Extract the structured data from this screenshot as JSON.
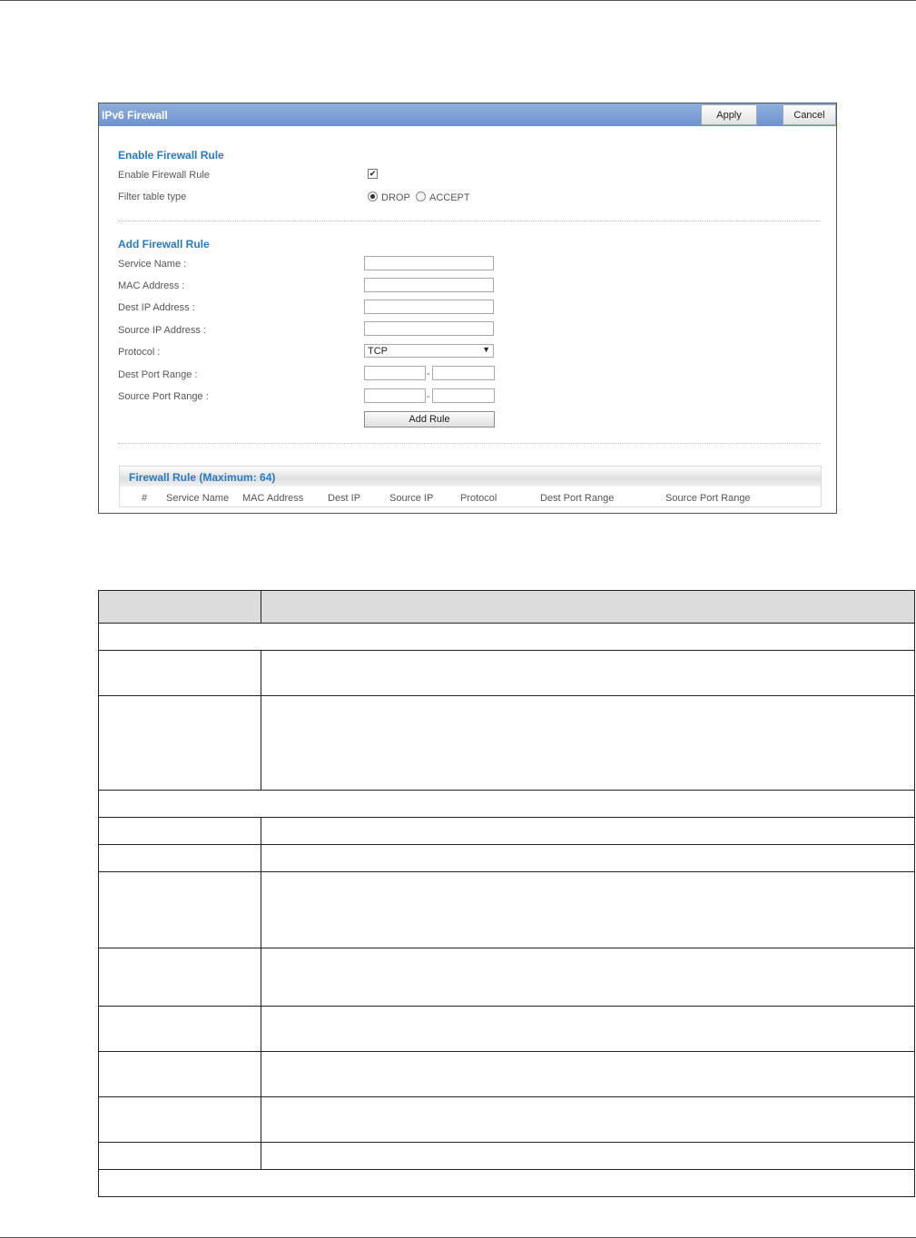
{
  "panel": {
    "title": "IPv6 Firewall",
    "apply_label": "Apply",
    "cancel_label": "Cancel",
    "enable_section": {
      "title": "Enable Firewall Rule",
      "enable_label": "Enable Firewall Rule",
      "enable_checked": true,
      "filter_label": "Filter table type",
      "filter_options": [
        "DROP",
        "ACCEPT"
      ],
      "filter_selected": "DROP"
    },
    "add_section": {
      "title": "Add Firewall Rule",
      "service_name_label": "Service Name :",
      "mac_address_label": "MAC Address :",
      "dest_ip_label": "Dest IP Address :",
      "source_ip_label": "Source IP Address :",
      "protocol_label": "Protocol :",
      "protocol_value": "TCP",
      "dest_port_label": "Dest Port Range :",
      "source_port_label": "Source Port Range :",
      "range_separator": "-",
      "add_rule_label": "Add Rule"
    },
    "rule_table": {
      "title": "Firewall Rule (Maximum: 64)",
      "columns": [
        "#",
        "Service Name",
        "MAC Address",
        "Dest IP",
        "Source IP",
        "Protocol",
        "Dest Port Range",
        "Source Port Range"
      ]
    }
  },
  "doc_table": {
    "rows": [
      {
        "type": "head",
        "cells": [
          "",
          ""
        ]
      },
      {
        "type": "span",
        "cells": [
          ""
        ]
      },
      {
        "type": "pair",
        "cells": [
          "",
          ""
        ]
      },
      {
        "type": "pair",
        "cells": [
          "",
          ""
        ]
      },
      {
        "type": "span",
        "cells": [
          ""
        ]
      },
      {
        "type": "pair",
        "cells": [
          "",
          ""
        ]
      },
      {
        "type": "pair",
        "cells": [
          "",
          ""
        ]
      },
      {
        "type": "pair",
        "cells": [
          "",
          ""
        ]
      },
      {
        "type": "pair",
        "cells": [
          "",
          ""
        ]
      },
      {
        "type": "pair",
        "cells": [
          "",
          ""
        ]
      },
      {
        "type": "pair",
        "cells": [
          "",
          ""
        ]
      },
      {
        "type": "pair",
        "cells": [
          "",
          ""
        ]
      },
      {
        "type": "pair",
        "cells": [
          "",
          ""
        ]
      },
      {
        "type": "span",
        "cells": [
          ""
        ]
      }
    ]
  }
}
